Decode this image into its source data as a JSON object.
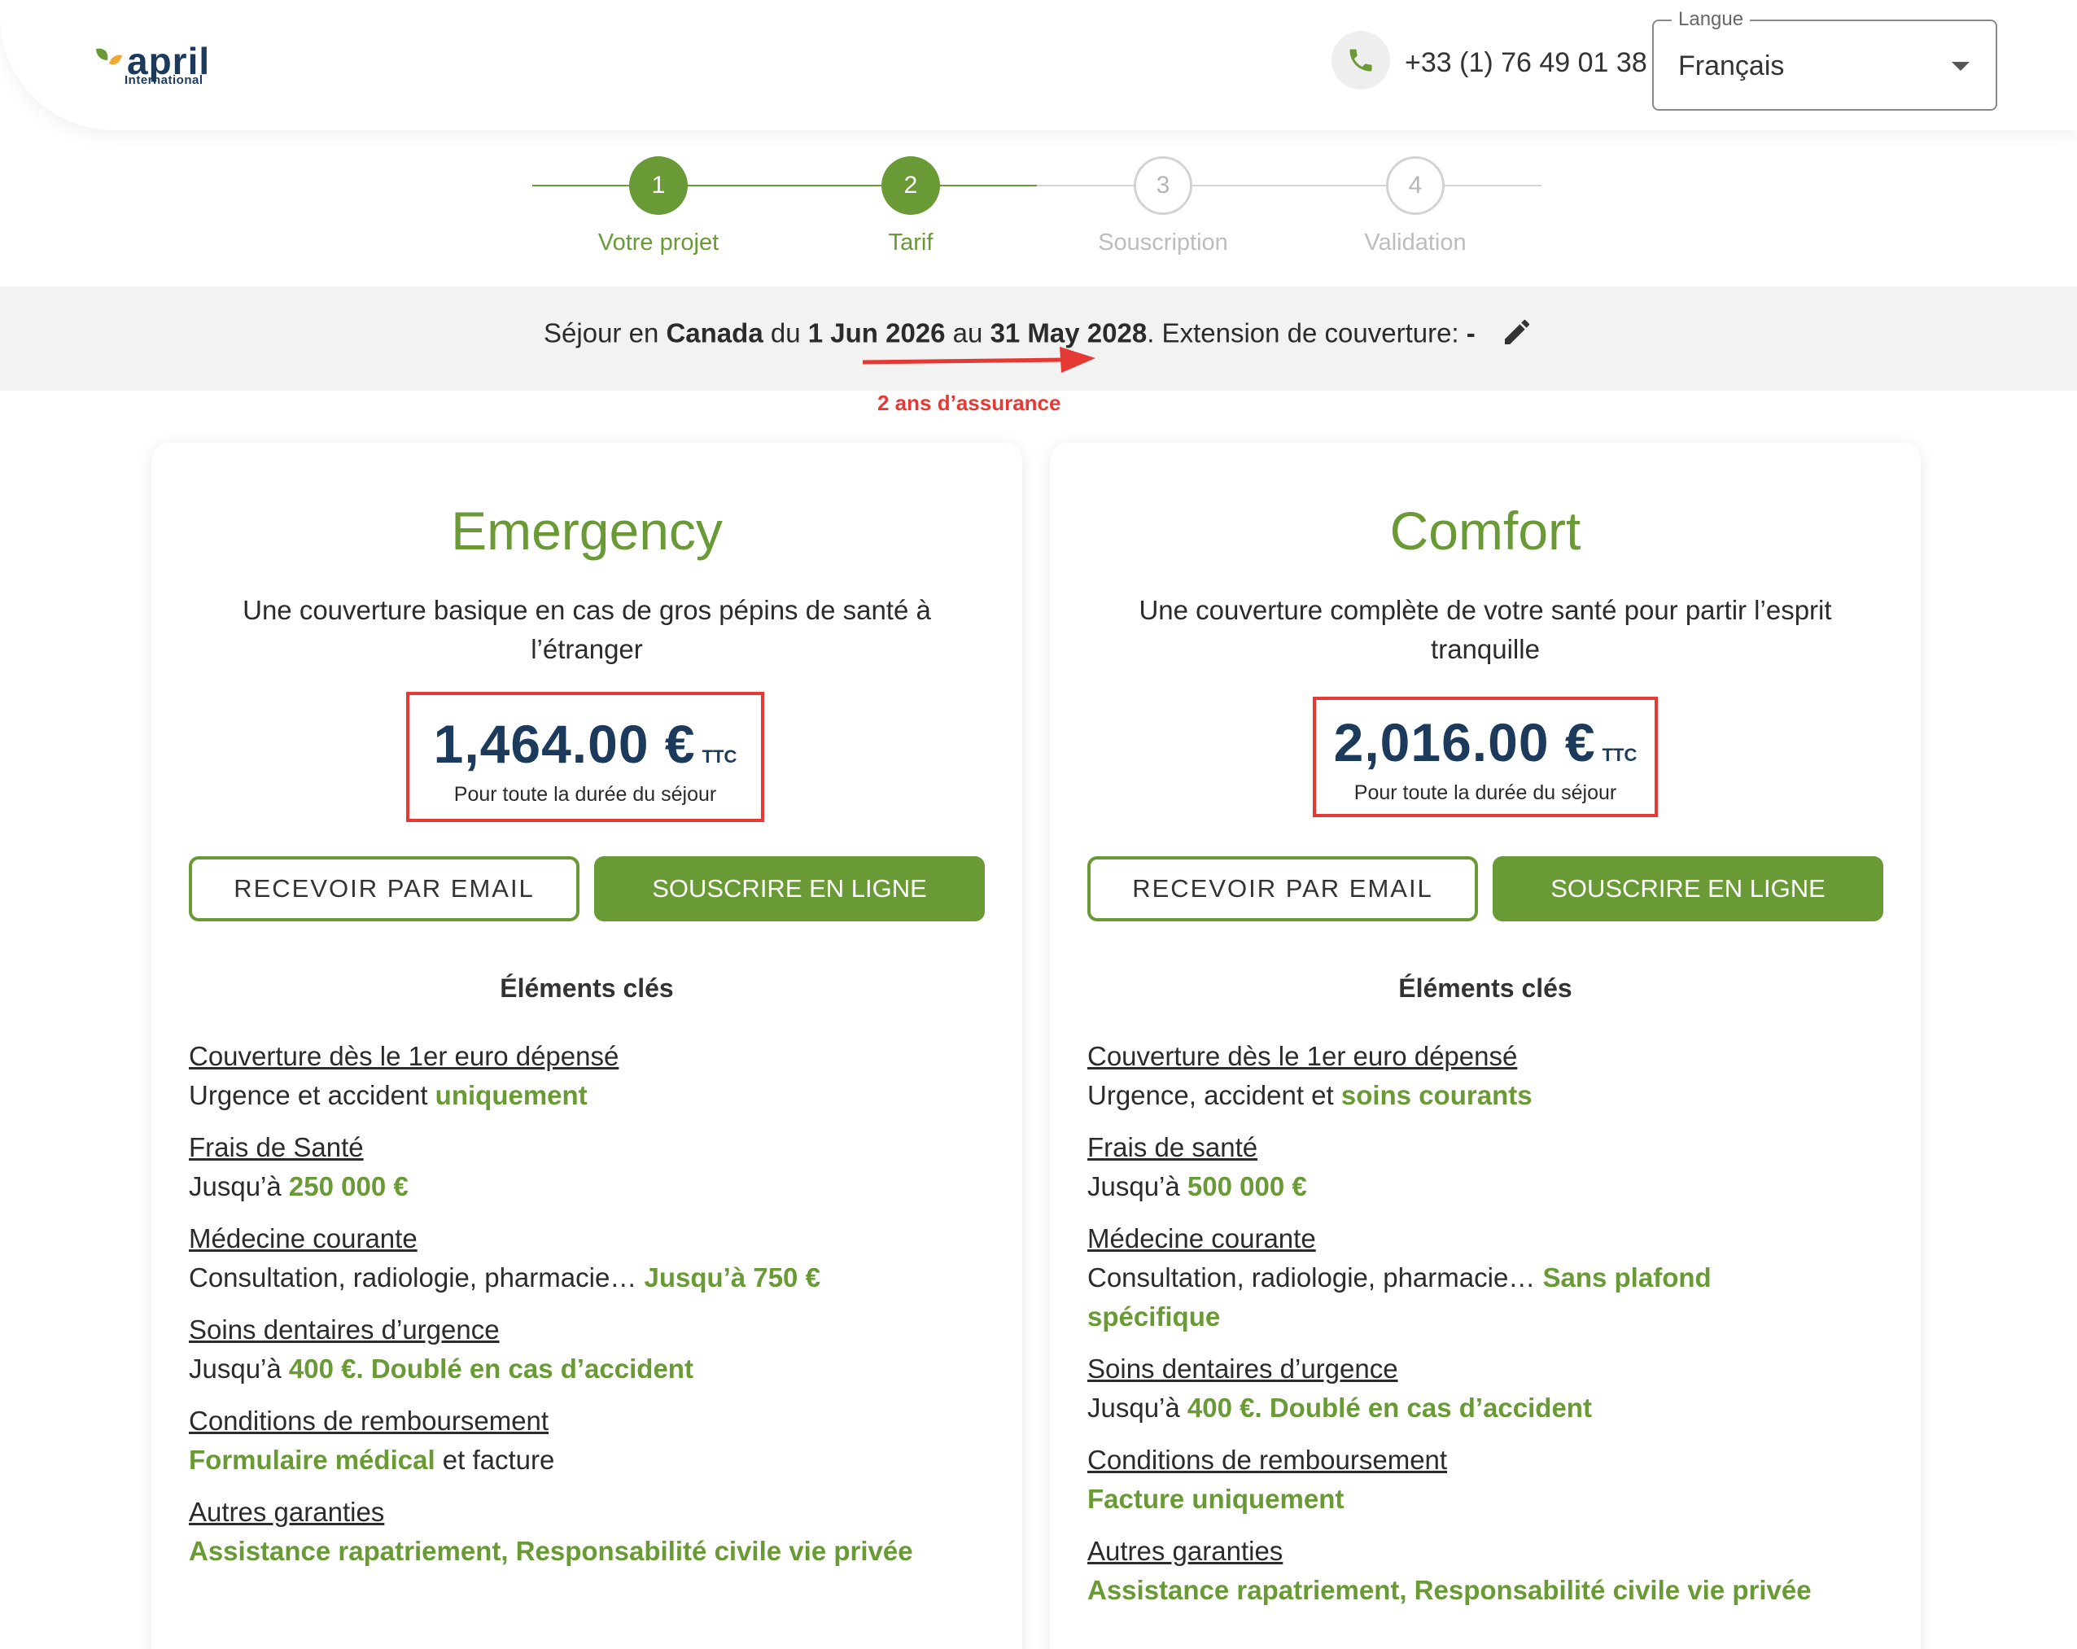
{
  "header": {
    "logo_brand": "april",
    "logo_sub": "International",
    "phone": "+33 (1) 76 49 01 38",
    "language": {
      "legend": "Langue",
      "value": "Français"
    }
  },
  "steps": [
    {
      "number": "1",
      "label": "Votre projet",
      "state": "done"
    },
    {
      "number": "2",
      "label": "Tarif",
      "state": "done"
    },
    {
      "number": "3",
      "label": "Souscription",
      "state": "todo"
    },
    {
      "number": "4",
      "label": "Validation",
      "state": "todo"
    }
  ],
  "summary": {
    "t1": "Séjour en ",
    "country": "Canada",
    "t2": " du ",
    "start": "1 Jun 2026",
    "t3": " au ",
    "end": "31 May 2028",
    "t4": ". Extension de couverture: ",
    "extension": "-"
  },
  "annotation": "2 ans d’assurance",
  "colors": {
    "accent": "#6a9a36",
    "navy": "#1b3a5c",
    "highlight": "#e53935"
  },
  "cards": [
    {
      "title": "Emergency",
      "description": "Une couverture basique en cas de gros pépins de santé à l’étranger",
      "price": "1,464.00 €",
      "ttc": "TTC",
      "price_note": "Pour toute la durée du séjour",
      "btn_email": "RECEVOIR PAR EMAIL",
      "btn_subscribe": "SOUSCRIRE EN LIGNE",
      "keys_title": "Éléments clés",
      "features": [
        {
          "head": "Couverture dès le 1er euro dépensé",
          "pre": "Urgence et accident ",
          "hl": "uniquement",
          "post": ""
        },
        {
          "head": "Frais de Santé",
          "pre": "Jusqu’à ",
          "hl": "250 000 €",
          "post": ""
        },
        {
          "head": "Médecine courante",
          "pre": "Consultation, radiologie, pharmacie… ",
          "hl": "Jusqu’à 750 €",
          "post": ""
        },
        {
          "head": "Soins dentaires d’urgence",
          "pre": "Jusqu’à ",
          "hl": "400 €. Doublé en cas d’accident",
          "post": ""
        },
        {
          "head": "Conditions de remboursement",
          "pre": "",
          "hl": "Formulaire médical",
          "post": " et facture"
        },
        {
          "head": "Autres garanties",
          "pre": "",
          "hl": "Assistance rapatriement, Responsabilité civile vie privée",
          "post": ""
        }
      ]
    },
    {
      "title": "Comfort",
      "description": "Une couverture complète de votre santé pour partir l’esprit tranquille",
      "price": "2,016.00 €",
      "ttc": "TTC",
      "price_note": "Pour toute la durée du séjour",
      "btn_email": "RECEVOIR PAR EMAIL",
      "btn_subscribe": "SOUSCRIRE EN LIGNE",
      "keys_title": "Éléments clés",
      "features": [
        {
          "head": "Couverture dès le 1er euro dépensé",
          "pre": "Urgence, accident et ",
          "hl": "soins courants",
          "post": ""
        },
        {
          "head": "Frais de santé",
          "pre": "Jusqu’à ",
          "hl": "500 000 €",
          "post": ""
        },
        {
          "head": "Médecine courante",
          "pre": "Consultation, radiologie, pharmacie… ",
          "hl": "Sans plafond spécifique",
          "post": ""
        },
        {
          "head": "Soins dentaires d’urgence",
          "pre": "Jusqu’à ",
          "hl": "400 €. Doublé en cas d’accident",
          "post": ""
        },
        {
          "head": "Conditions de remboursement",
          "pre": "",
          "hl": "Facture uniquement",
          "post": ""
        },
        {
          "head": "Autres garanties",
          "pre": "",
          "hl": "Assistance rapatriement, Responsabilité civile vie privée",
          "post": ""
        }
      ]
    }
  ]
}
